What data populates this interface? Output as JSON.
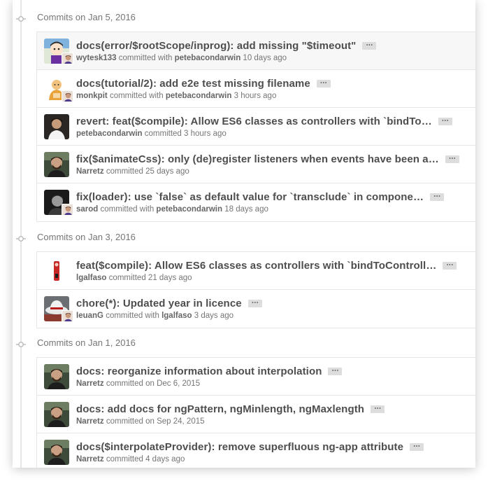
{
  "groups": [
    {
      "title": "Commits on Jan 5, 2016",
      "commits": [
        {
          "message": "docs(error/$rootScope/inprog): add missing \"$timeout\"",
          "author": "wytesk133",
          "verb": "committed with",
          "coauthor": "petebacondarwin",
          "time": "10 days ago",
          "avatar": "cartoon-avatar",
          "mini": true,
          "highlight": true
        },
        {
          "message": "docs(tutorial/2): add e2e test missing filename",
          "author": "monkpit",
          "verb": "committed with",
          "coauthor": "petebacondarwin",
          "time": "3 hours ago",
          "avatar": "monk-avatar",
          "mini": true,
          "highlight": false
        },
        {
          "message": "revert: feat($compile): Allow ES6 classes as controllers with `bindTo…",
          "author": "petebacondarwin",
          "verb": "committed",
          "coauthor": "",
          "time": "3 hours ago",
          "avatar": "photo-avatar-dark",
          "mini": false,
          "highlight": false
        },
        {
          "message": "fix($animateCss): only (de)register listeners when events have been a…",
          "author": "Narretz",
          "verb": "committed",
          "coauthor": "",
          "time": "25 days ago",
          "avatar": "photo-avatar-beard",
          "mini": false,
          "highlight": false
        },
        {
          "message": "fix(loader): use `false` as default value for `transclude` in compone…",
          "author": "sarod",
          "verb": "committed with",
          "coauthor": "petebacondarwin",
          "time": "18 days ago",
          "avatar": "photo-avatar-bw",
          "mini": true,
          "highlight": false
        }
      ]
    },
    {
      "title": "Commits on Jan 3, 2016",
      "commits": [
        {
          "message": "feat($compile): Allow ES6 classes as controllers with `bindToControll…",
          "author": "lgalfaso",
          "verb": "committed",
          "coauthor": "",
          "time": "21 days ago",
          "avatar": "red-figure-avatar",
          "mini": false,
          "highlight": false
        },
        {
          "message": "chore(*): Updated year in licence",
          "author": "IeuanG",
          "verb": "committed with",
          "coauthor": "lgalfaso",
          "time": "3 days ago",
          "avatar": "hat-avatar",
          "mini": true,
          "highlight": false
        }
      ]
    },
    {
      "title": "Commits on Jan 1, 2016",
      "commits": [
        {
          "message": "docs: reorganize information about interpolation",
          "author": "Narretz",
          "verb": "committed on",
          "coauthor": "",
          "time": "Dec 6, 2015",
          "avatar": "photo-avatar-beard",
          "mini": false,
          "highlight": false
        },
        {
          "message": "docs: add docs for ngPattern, ngMinlength, ngMaxlength",
          "author": "Narretz",
          "verb": "committed on",
          "coauthor": "",
          "time": "Sep 24, 2015",
          "avatar": "photo-avatar-beard",
          "mini": false,
          "highlight": false
        },
        {
          "message": "docs($interpolateProvider): remove superfluous ng-app attribute",
          "author": "Narretz",
          "verb": "committed",
          "coauthor": "",
          "time": "4 days ago",
          "avatar": "photo-avatar-beard",
          "mini": false,
          "highlight": false
        }
      ]
    }
  ],
  "ellipsis_label": "⋯"
}
